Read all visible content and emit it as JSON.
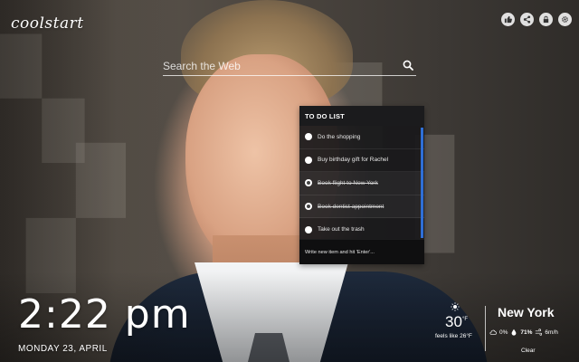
{
  "logo": {
    "text": "coolstart"
  },
  "top_icons": [
    "thumbs-up-icon",
    "share-icon",
    "lock-icon",
    "settings-icon"
  ],
  "search": {
    "placeholder": "Search the Web",
    "value": ""
  },
  "todo": {
    "title": "TO DO LIST",
    "items": [
      {
        "text": "Do the shopping",
        "done": false
      },
      {
        "text": "Buy birthday gift for Rachel",
        "done": false
      },
      {
        "text": "Book flight to New York",
        "done": true
      },
      {
        "text": "Book dentist appointment",
        "done": true
      },
      {
        "text": "Take out the trash",
        "done": false
      }
    ],
    "new_item_placeholder": "Write new item and hit 'Enter'..."
  },
  "clock": {
    "time": "2:22 pm",
    "date": "MONDAY 23, APRIL"
  },
  "weather": {
    "temp": "30",
    "unit": "°F",
    "feels_like": "feels like 26°F",
    "city": "New York",
    "cloud": "0%",
    "humidity": "71%",
    "wind": "6m/h",
    "condition": "Clear"
  },
  "colors": {
    "accent": "#2f6fd6",
    "panel": "#18181a"
  }
}
